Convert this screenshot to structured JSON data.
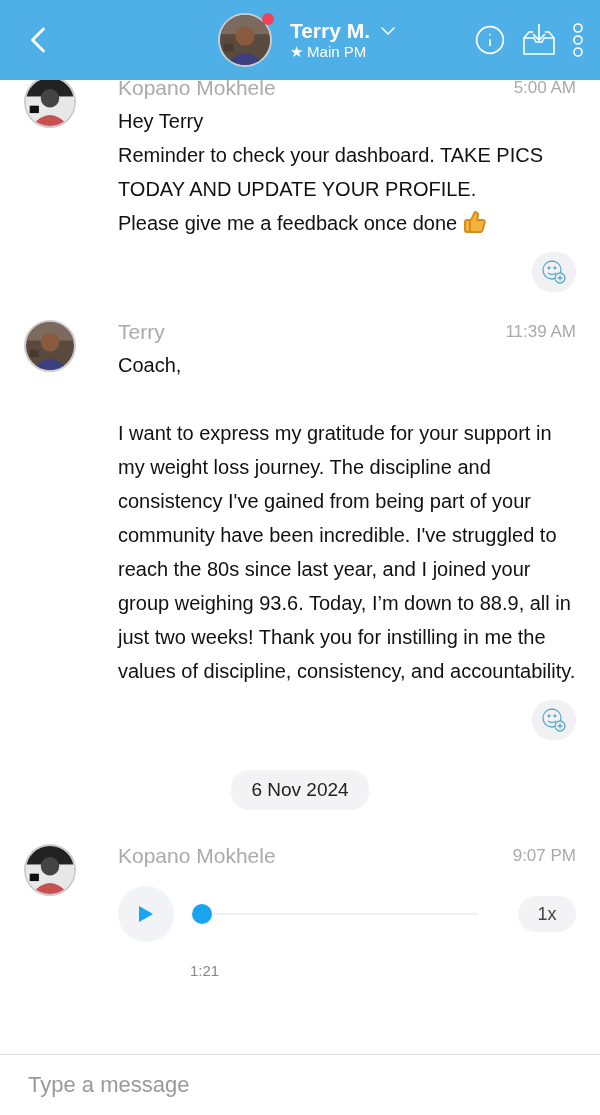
{
  "header": {
    "title": "Terry M.",
    "subtitle": "★ Main PM",
    "online": true
  },
  "messages": [
    {
      "kind": "text",
      "sender": "Kopano Mokhele",
      "time": "5:00 AM",
      "paragraphs": [
        [
          "Hey Terry",
          "Reminder to check your dashboard. TAKE PICS TODAY AND UPDATE YOUR PROFILE.",
          "Please give me a feedback once done"
        ]
      ],
      "ends_with_emoji": true
    },
    {
      "kind": "text",
      "sender": "Terry",
      "time": "11:39 AM",
      "ends_with_emoji": false,
      "paragraphs": [
        [
          "Coach,"
        ],
        [
          "I want to express my gratitude for your support in my weight loss journey. The discipline and consistency I've gained from being part of your community have been incredible. I've struggled to reach the 80s since last year, and I joined your group weighing 93.6. Today, I’m down to 88.9, all in just two weeks! Thank you for instilling in me the values of discipline, consistency, and accountability."
        ]
      ]
    },
    {
      "kind": "date",
      "label": "6 Nov 2024"
    },
    {
      "kind": "audio",
      "sender": "Kopano Mokhele",
      "time": "9:07 PM",
      "level": 0,
      "speed": "1x",
      "duration": "1:21"
    }
  ],
  "composer": {
    "placeholder": "Type a message"
  }
}
